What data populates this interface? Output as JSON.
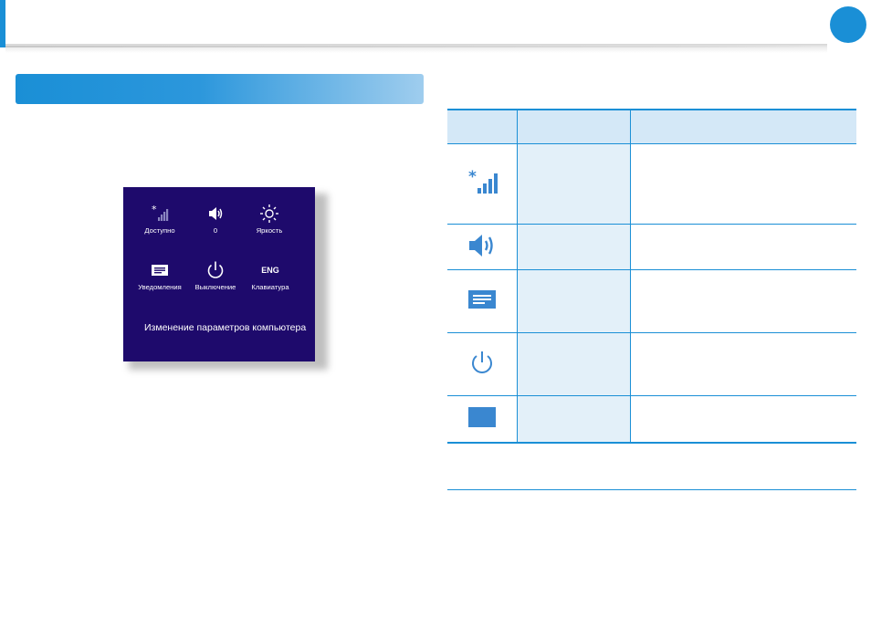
{
  "header": {
    "accent_color": "#1a8fd6",
    "page_badge_color": "#1a8fd6"
  },
  "section_banner": {
    "gradient_start": "#1a8fd6",
    "gradient_end": "#9fcdee"
  },
  "charm_panel": {
    "background": "#1e0a6c",
    "tiles": [
      {
        "icon": "wifi-signal-icon",
        "label": "Доступно"
      },
      {
        "icon": "speaker-icon",
        "label": "0"
      },
      {
        "icon": "brightness-icon",
        "label": "Яркость"
      },
      {
        "icon": "notifications-icon",
        "label": "Уведомления"
      },
      {
        "icon": "power-icon",
        "label": "Выключение"
      },
      {
        "icon": "keyboard-icon",
        "label": "Клавиатура",
        "glyph": "ENG"
      }
    ],
    "link": "Изменение параметров компьютера"
  },
  "table": {
    "header_color": "#d4e8f7",
    "rows": [
      {
        "icon": "network-signal-icon"
      },
      {
        "icon": "volume-icon"
      },
      {
        "icon": "notifications-icon"
      },
      {
        "icon": "power-icon"
      },
      {
        "icon": "keyboard-language-icon"
      }
    ]
  }
}
